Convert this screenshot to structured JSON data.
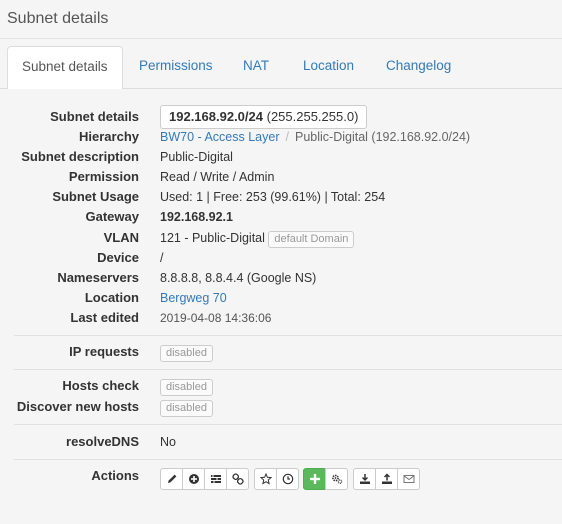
{
  "page_title": "Subnet details",
  "tabs": [
    {
      "label": "Subnet details",
      "active": true
    },
    {
      "label": "Permissions"
    },
    {
      "label": "NAT"
    },
    {
      "label": "Location"
    },
    {
      "label": "Changelog"
    }
  ],
  "details": {
    "subnet": {
      "label": "Subnet details",
      "cidr": "192.168.92.0/24",
      "mask": "(255.255.255.0)"
    },
    "hierarchy": {
      "label": "Hierarchy",
      "parent_link": "BW70 - Access Layer",
      "separator": "/",
      "current": "Public-Digital (192.168.92.0/24)"
    },
    "description": {
      "label": "Subnet description",
      "value": "Public-Digital"
    },
    "permission": {
      "label": "Permission",
      "value": "Read / Write / Admin"
    },
    "usage": {
      "label": "Subnet Usage",
      "value": "Used: 1 | Free: 253 (99.61%) | Total: 254"
    },
    "gateway": {
      "label": "Gateway",
      "value": "192.168.92.1"
    },
    "vlan": {
      "label": "VLAN",
      "value": "121 - Public-Digital",
      "domain_badge": "default Domain"
    },
    "device": {
      "label": "Device",
      "value": "/"
    },
    "nameservers": {
      "label": "Nameservers",
      "value": "8.8.8.8, 8.8.4.4 (Google NS)"
    },
    "location": {
      "label": "Location",
      "value": "Bergweg 70"
    },
    "last_edited": {
      "label": "Last edited",
      "value": "2019-04-08 14:36:06"
    }
  },
  "ip_requests": {
    "label": "IP requests",
    "badge": "disabled"
  },
  "hosts_check": {
    "label": "Hosts check",
    "badge": "disabled"
  },
  "discover": {
    "label": "Discover new hosts",
    "badge": "disabled"
  },
  "resolve_dns": {
    "label": "resolveDNS",
    "value": "No"
  },
  "actions": {
    "label": "Actions",
    "groups": [
      [
        "pencil-icon",
        "plus-circle-icon",
        "tasks-icon",
        "link-icon"
      ],
      [
        "star-icon",
        "clock-icon"
      ],
      [
        "plus-icon",
        "cogs-icon"
      ],
      [
        "download-icon",
        "upload-icon",
        "envelope-icon"
      ]
    ],
    "accent_color": "#5cb85c"
  }
}
